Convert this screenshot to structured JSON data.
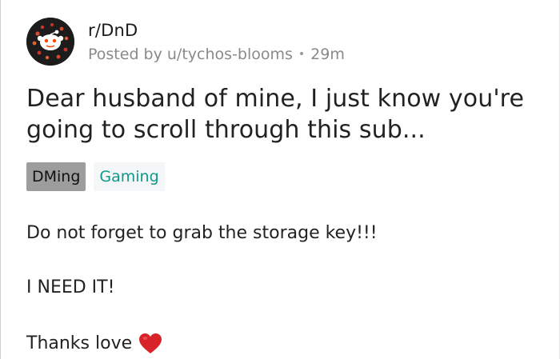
{
  "post": {
    "subreddit": "r/DnD",
    "posted_by": "Posted by u/tychos-blooms",
    "separator": "•",
    "age": "29m",
    "title": "Dear husband of mine, I just know you're going to scroll through this sub...",
    "flairs": [
      "DMing",
      "Gaming"
    ],
    "body": {
      "line1": "Do not forget to grab the storage key!!!",
      "line2": "I NEED IT!",
      "line3": "Thanks love"
    }
  },
  "colors": {
    "flair_dming_bg": "#9d9d9d",
    "flair_gaming_text": "#0e9a8a",
    "heart": "#d8232a",
    "meta_gray": "#8a8a8a"
  },
  "icons": {
    "avatar": "subreddit-avatar-icon",
    "heart": "red-heart-emoji-icon"
  }
}
